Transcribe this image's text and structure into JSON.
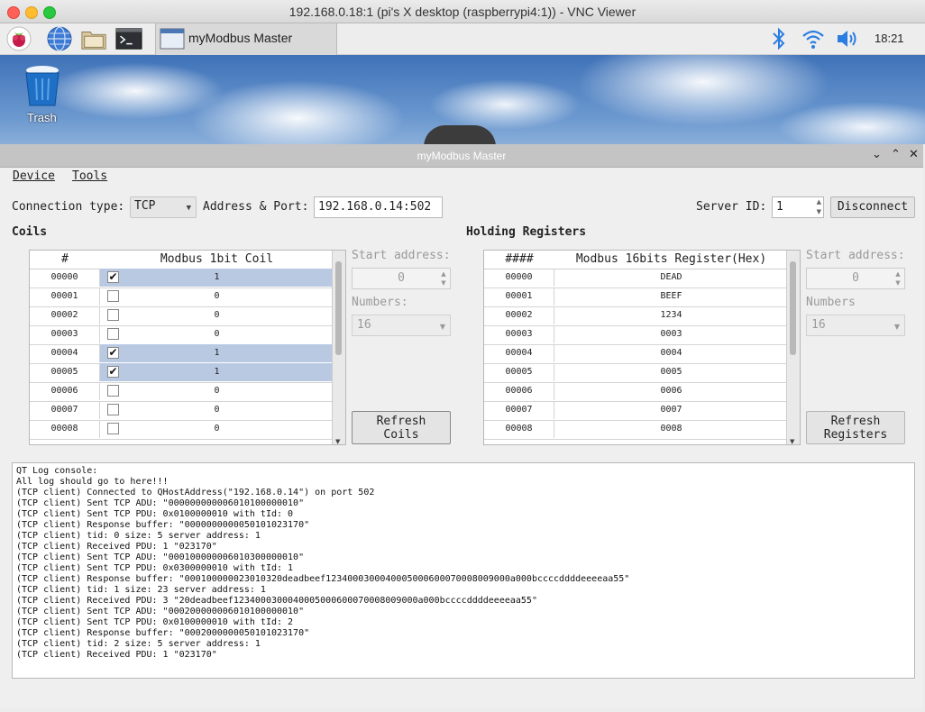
{
  "mac_window": {
    "title": "192.168.0.18:1 (pi's X desktop (raspberrypi4:1)) - VNC Viewer"
  },
  "taskbar": {
    "task_label": "myModbus Master",
    "clock": "18:21"
  },
  "desktop": {
    "trash_label": "Trash"
  },
  "app": {
    "title": "myModbus Master",
    "menu": [
      "Device",
      "Tools"
    ],
    "connection_label": "Connection type:",
    "connection_value": "TCP",
    "address_label": "Address & Port:",
    "address_value": "192.168.0.14:502",
    "server_id_label": "Server ID:",
    "server_id_value": "1",
    "disconnect_label": "Disconnect",
    "coils": {
      "title": "Coils",
      "col_index": "#",
      "col_value": "Modbus 1bit Coil",
      "rows": [
        {
          "addr": "00000",
          "checked": true,
          "value": "1"
        },
        {
          "addr": "00001",
          "checked": false,
          "value": "0"
        },
        {
          "addr": "00002",
          "checked": false,
          "value": "0"
        },
        {
          "addr": "00003",
          "checked": false,
          "value": "0"
        },
        {
          "addr": "00004",
          "checked": true,
          "value": "1"
        },
        {
          "addr": "00005",
          "checked": true,
          "value": "1"
        },
        {
          "addr": "00006",
          "checked": false,
          "value": "0"
        },
        {
          "addr": "00007",
          "checked": false,
          "value": "0"
        },
        {
          "addr": "00008",
          "checked": false,
          "value": "0"
        }
      ],
      "start_label": "Start address:",
      "start_value": "0",
      "numbers_label": "Numbers:",
      "numbers_value": "16",
      "refresh_label": "Refresh\nCoils"
    },
    "registers": {
      "title": "Holding Registers",
      "col_index": "####",
      "col_value": "Modbus 16bits Register(Hex)",
      "rows": [
        {
          "addr": "00000",
          "value": "DEAD"
        },
        {
          "addr": "00001",
          "value": "BEEF"
        },
        {
          "addr": "00002",
          "value": "1234"
        },
        {
          "addr": "00003",
          "value": "0003"
        },
        {
          "addr": "00004",
          "value": "0004"
        },
        {
          "addr": "00005",
          "value": "0005"
        },
        {
          "addr": "00006",
          "value": "0006"
        },
        {
          "addr": "00007",
          "value": "0007"
        },
        {
          "addr": "00008",
          "value": "0008"
        }
      ],
      "start_label": "Start address:",
      "start_value": "0",
      "numbers_label": "Numbers",
      "numbers_value": "16",
      "refresh_label": "Refresh\nRegisters"
    },
    "console_lines": [
      "QT Log console:",
      "All log should go to here!!!",
      "(TCP client) Connected to QHostAddress(\"192.168.0.14\") on port 502",
      "(TCP client) Sent TCP ADU: \"000000000006010100000010\"",
      "(TCP client) Sent TCP PDU: 0x0100000010 with tId: 0",
      "(TCP client) Response buffer: \"0000000000050101023170\"",
      "(TCP client) tid: 0 size: 5 server address: 1",
      "(TCP client) Received PDU: 1 \"023170\"",
      "(TCP client) Sent TCP ADU: \"000100000006010300000010\"",
      "(TCP client) Sent TCP PDU: 0x0300000010 with tId: 1",
      "(TCP client) Response buffer: \"000100000023010320deadbeef1234000300040005000600070008009000a000bccccddddeeeeaa55\"",
      "(TCP client) tid: 1 size: 23 server address: 1",
      "(TCP client) Received PDU: 3 \"20deadbeef1234000300040005000600070008009000a000bccccddddeeeeaa55\"",
      "(TCP client) Sent TCP ADU: \"000200000006010100000010\"",
      "(TCP client) Sent TCP PDU: 0x0100000010 with tId: 2",
      "(TCP client) Response buffer: \"0002000000050101023170\"",
      "(TCP client) tid: 2 size: 5 server address: 1",
      "(TCP client) Received PDU: 1 \"023170\""
    ]
  },
  "colors": {
    "selected_row": "#b9c9e2",
    "mac_close": "#fe5f57",
    "mac_min": "#febc2e",
    "mac_max": "#28c840"
  }
}
